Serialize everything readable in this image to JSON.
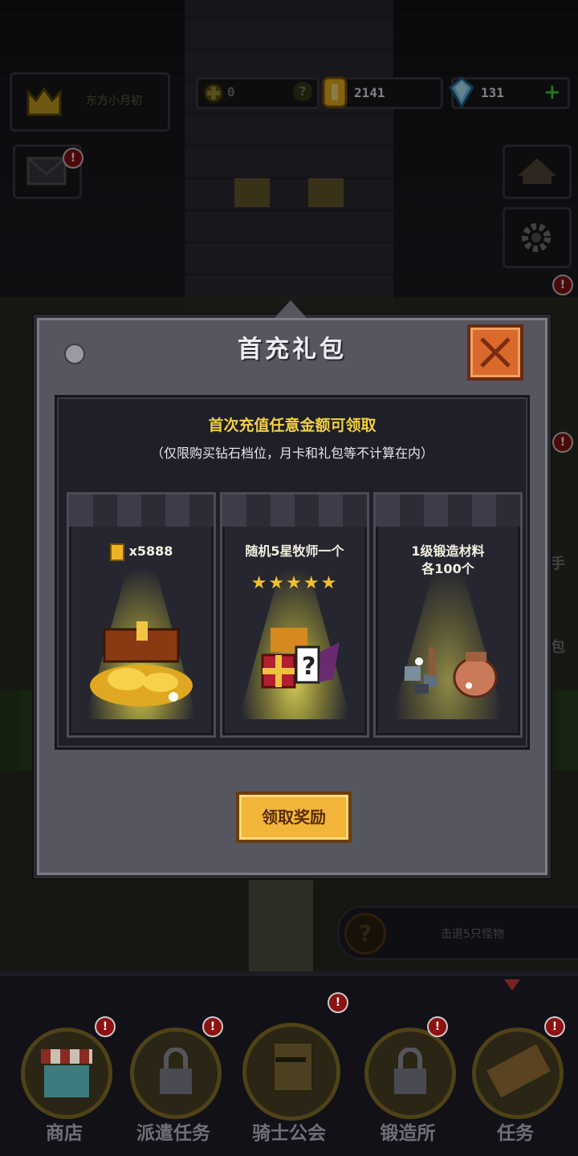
{
  "topbar": {
    "player_name": "东方小月初",
    "tokens": "0",
    "tokens_help": "?",
    "gold": "2141",
    "gems": "131",
    "gems_add": "+"
  },
  "side": {
    "badge": "!",
    "hint_bag": "包",
    "hint_hand": "手"
  },
  "quest_hint": "击退5只怪物",
  "modal": {
    "title": "首充礼包",
    "subtitle": "首次充值任意金额可领取",
    "note": "（仅限购买钻石档位，月卡和礼包等不计算在内）",
    "cards": [
      {
        "title": "x5888"
      },
      {
        "title": "随机5星牧师一个",
        "stars": "★★★★★"
      },
      {
        "title_line1": "1级锻造材料",
        "title_line2": "各100个"
      }
    ],
    "claim_label": "领取奖励"
  },
  "nav": [
    {
      "label": "商店",
      "badge": "!"
    },
    {
      "label": "派遣任务",
      "badge": "!"
    },
    {
      "label": "骑士公会",
      "badge": "!"
    },
    {
      "label": "锻造所",
      "badge": "!"
    },
    {
      "label": "任务",
      "badge": "!"
    }
  ],
  "colors": {
    "gold_text": "#f1cf42",
    "button": "#f2b53a",
    "close": "#d96a2c",
    "badge_red": "#8c1111"
  }
}
